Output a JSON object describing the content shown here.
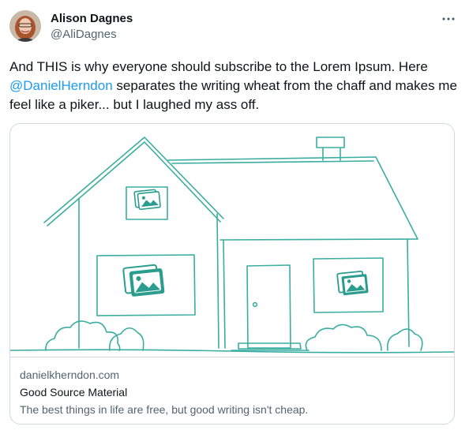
{
  "author": {
    "name": "Alison Dagnes",
    "handle": "@AliDagnes"
  },
  "tweet": {
    "text_before": "And THIS is why everyone should subscribe to the Lorem Ipsum. Here ",
    "mention": "@DanielHerndon",
    "text_after": " separates the writing wheat from the chaff and makes me feel like a piker... but I laughed my ass off."
  },
  "card": {
    "domain": "danielkherndon.com",
    "title": "Good Source Material",
    "description": "The best things in life are free, but good writing isn't cheap."
  },
  "icons": {
    "more": "more-horizontal-icon",
    "avatar": "profile-photo",
    "image": "house-sketch-illustration"
  },
  "colors": {
    "text": "#0f1419",
    "secondary": "#536471",
    "link": "#1d9bf0",
    "border": "#cfd9de",
    "sketch": "#3aada0"
  }
}
